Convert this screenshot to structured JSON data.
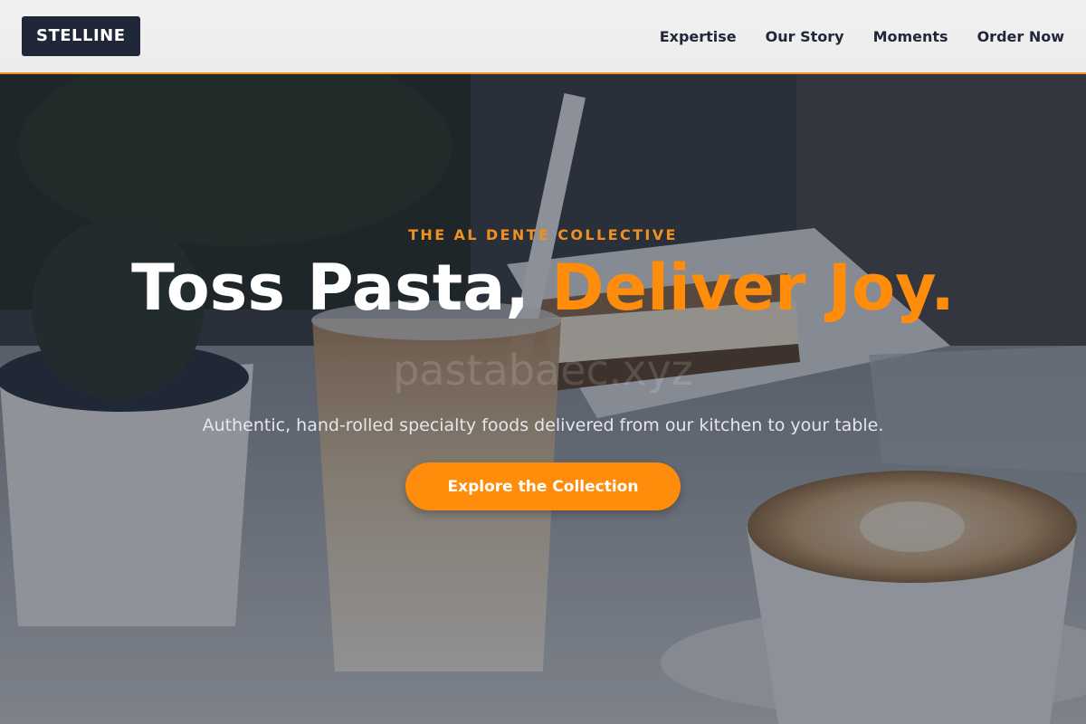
{
  "header": {
    "logo": "STELLINE",
    "nav": [
      {
        "label": "Expertise"
      },
      {
        "label": "Our Story"
      },
      {
        "label": "Moments"
      },
      {
        "label": "Order Now"
      }
    ]
  },
  "hero": {
    "eyebrow": "THE AL DENTE COLLECTIVE",
    "headline_main": "Toss Pasta, ",
    "headline_accent": "Deliver Joy.",
    "subtitle": "Authentic, hand-rolled specialty foods delivered from our kitchen to your table.",
    "cta_label": "Explore the Collection",
    "watermark": "pastabaec.xyz"
  },
  "colors": {
    "accent": "#ff8c0a",
    "navy": "#1f2738",
    "header_bg": "#efefef"
  }
}
